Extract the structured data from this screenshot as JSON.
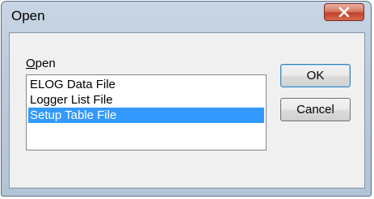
{
  "window": {
    "title": "Open"
  },
  "list": {
    "label_prefix": "",
    "label_mnemonic": "O",
    "label_rest": "pen",
    "items": [
      {
        "label": "ELOG Data File",
        "selected": false
      },
      {
        "label": "Logger List File",
        "selected": false
      },
      {
        "label": "Setup Table File",
        "selected": true
      }
    ]
  },
  "buttons": {
    "ok": "OK",
    "cancel": "Cancel"
  },
  "colors": {
    "selection": "#3399ff",
    "close_button": "#c2412a",
    "frame": "#bccbdc"
  }
}
